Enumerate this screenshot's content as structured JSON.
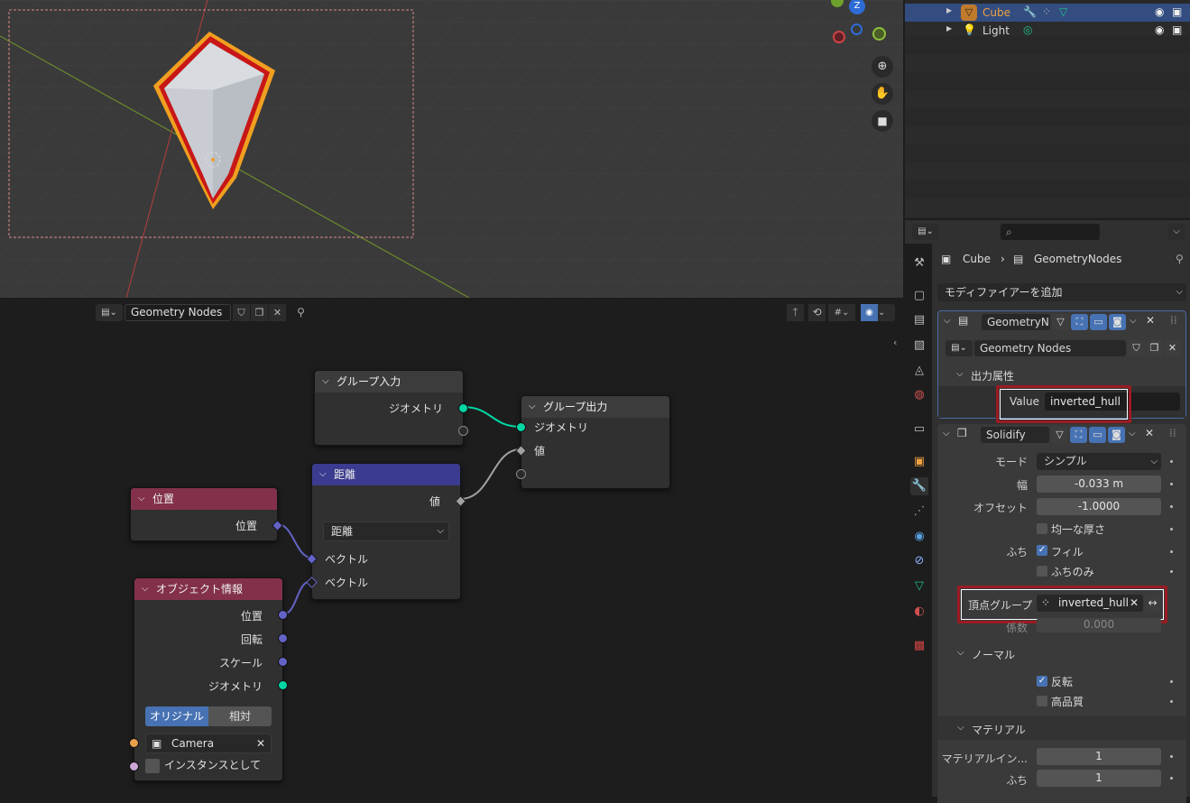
{
  "outliner": {
    "rows": [
      {
        "name": "Cube",
        "selected": true,
        "name_color": "#f0a040"
      },
      {
        "name": "Light",
        "selected": false,
        "name_color": "#d8d8d8"
      }
    ]
  },
  "node_editor": {
    "header": {
      "tree_name": "Geometry Nodes"
    },
    "nodes": {
      "group_input": {
        "title": "グループ入力",
        "out_geometry": "ジオメトリ"
      },
      "group_output": {
        "title": "グループ出力",
        "in_geometry": "ジオメトリ",
        "in_value": "値"
      },
      "distance": {
        "title": "距離",
        "out_value": "値",
        "mode": "距離",
        "in_vector1": "ベクトル",
        "in_vector2": "ベクトル"
      },
      "position": {
        "title": "位置",
        "out_position": "位置"
      },
      "object_info": {
        "title": "オブジェクト情報",
        "out_location": "位置",
        "out_rotation": "回転",
        "out_scale": "スケール",
        "out_geometry": "ジオメトリ",
        "btn_original": "オリジナル",
        "btn_relative": "相対",
        "object": "Camera",
        "as_instance": "インスタンスとして"
      }
    },
    "colors": {
      "geometry": "#00d6a3",
      "vector": "#6363c7",
      "float": "#a1a1a1",
      "input_header": "#83314a",
      "converter_header": "#3b3b8f",
      "group_header": "#3c3c3c"
    }
  },
  "properties": {
    "breadcrumb_object": "Cube",
    "breadcrumb_modifier": "GeometryNodes",
    "add_modifier": "モディファイアーを追加",
    "gn_modifier": {
      "name": "GeometryN...",
      "tree": "Geometry Nodes",
      "output_attrs_label": "出力属性",
      "value_label": "Value",
      "value_attr": "inverted_hull"
    },
    "solidify": {
      "name": "Solidify",
      "mode_label": "モード",
      "mode_value": "シンプル",
      "thickness_label": "幅",
      "thickness_value": "-0.033 m",
      "offset_label": "オフセット",
      "offset_value": "-1.0000",
      "even_label": "均一な厚さ",
      "rim_label": "ふち",
      "fill_label": "フィル",
      "rim_only_label": "ふちのみ",
      "vgroup_label": "頂点グループ",
      "vgroup_value": "inverted_hull",
      "factor_label": "係数",
      "factor_value": "0.000",
      "normals_label": "ノーマル",
      "flip_label": "反転",
      "hq_label": "高品質",
      "materials_label": "マテリアル",
      "mat_index_label": "マテリアルイン...",
      "mat_index_value": "1",
      "rim_mat_label": "ふち",
      "rim_mat_value": "1",
      "fill_checked": true,
      "flip_checked": true,
      "even_checked": false,
      "rim_only_checked": false,
      "hq_checked": false
    }
  },
  "viewport": {
    "axis_z": "Z",
    "icons": [
      "zoom-icon",
      "hand-icon",
      "camera-icon"
    ]
  }
}
